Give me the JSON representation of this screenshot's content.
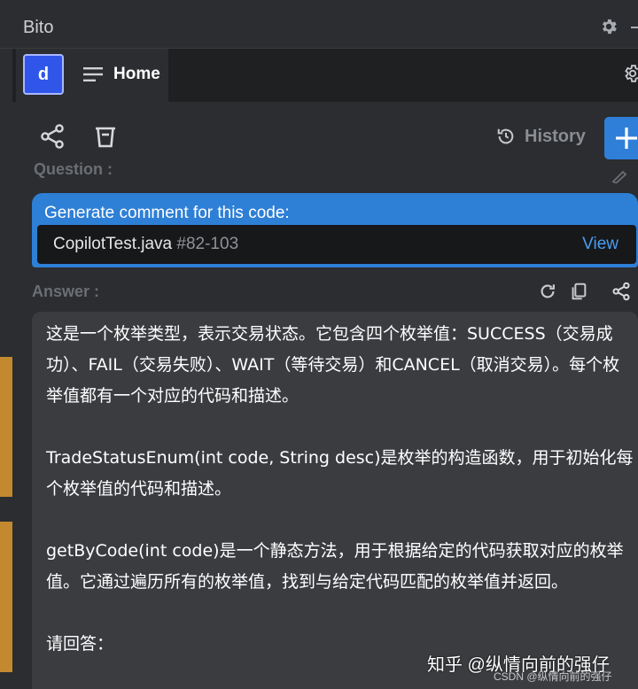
{
  "window": {
    "title": "Bito"
  },
  "tabs": [
    {
      "avatar_letter": "d",
      "label": "Home"
    }
  ],
  "toolbar": {
    "history_label": "History"
  },
  "question": {
    "label": "Question :",
    "text": "Generate comment for this code:",
    "file": "CopilotTest.java",
    "lines": "#82-103",
    "view_label": "View"
  },
  "answer": {
    "label": "Answer :",
    "paragraphs": [
      "这是一个枚举类型，表示交易状态。它包含四个枚举值：SUCCESS（交易成功）、FAIL（交易失败）、WAIT（等待交易）和CANCEL（取消交易）。每个枚举值都有一个对应的代码和描述。",
      "TradeStatusEnum(int code, String desc)是枚举的构造函数，用于初始化每个枚举值的代码和描述。",
      "getByCode(int code)是一个静态方法，用于根据给定的代码获取对应的枚举值。它通过遍历所有的枚举值，找到与给定代码匹配的枚举值并返回。",
      "请回答："
    ]
  },
  "watermark": {
    "main": "知乎 @纵情向前的强仔",
    "sub": "CSDN @纵情向前的强仔"
  },
  "icons": [
    "gear-icon",
    "menu-icon",
    "share-icon",
    "trash-icon",
    "history-icon",
    "plus-icon",
    "edit-icon",
    "refresh-icon",
    "copy-icon"
  ],
  "colors": {
    "accent": "#2e7fd6",
    "avatar": "#2f56e8",
    "link": "#4b9df0",
    "sidebar_marker": "#c2892f"
  }
}
